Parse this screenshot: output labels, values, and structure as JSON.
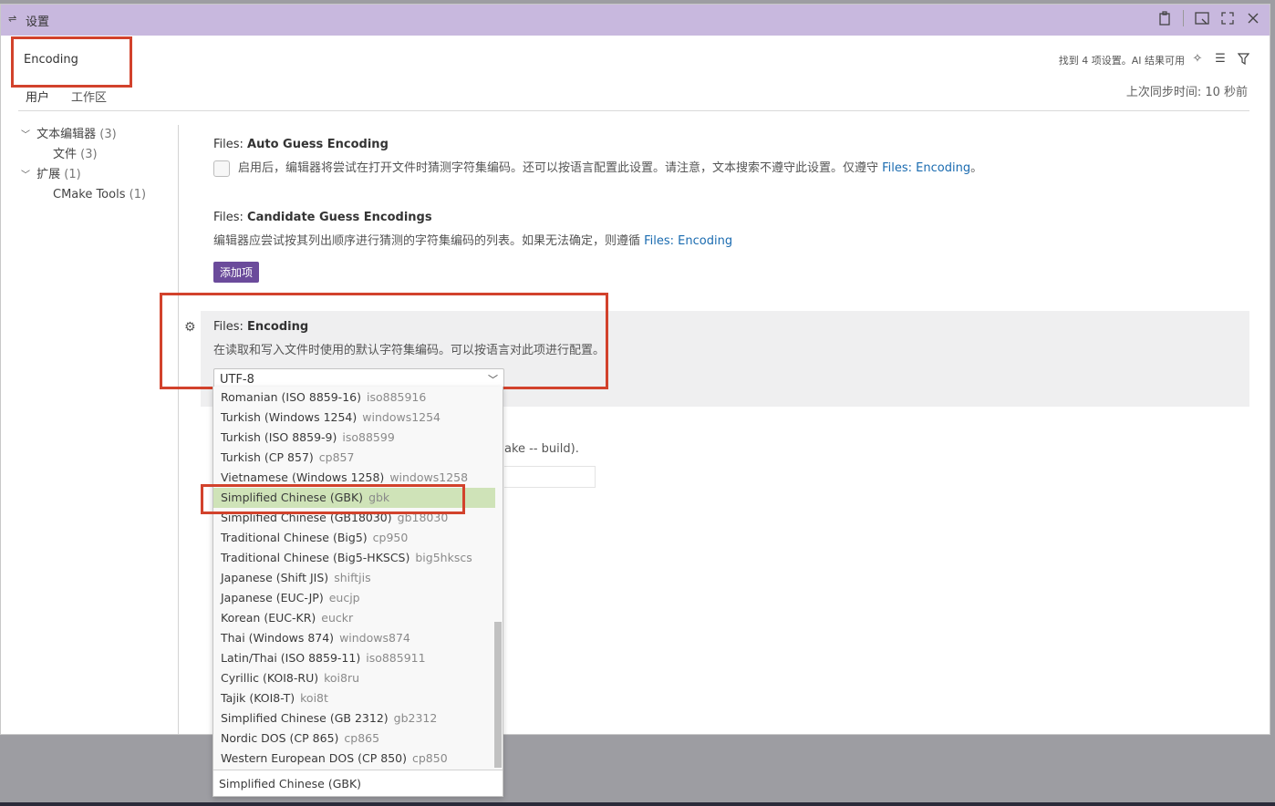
{
  "window": {
    "title": "设置"
  },
  "search": {
    "value": "Encoding",
    "status": "找到 4 项设置。AI 结果可用"
  },
  "tabs": [
    {
      "label": "用户"
    },
    {
      "label": "工作区"
    }
  ],
  "sync_status": "上次同步时间: 10 秒前",
  "toc": [
    {
      "label": "文本编辑器",
      "count": "(3)"
    },
    {
      "label": "文件",
      "count": "(3)"
    },
    {
      "label": "扩展",
      "count": "(1)"
    },
    {
      "label": "CMake Tools",
      "count": "(1)"
    }
  ],
  "settings": {
    "auto_guess": {
      "category": "Files: ",
      "name": "Auto Guess Encoding",
      "desc": "启用后，编辑器将尝试在打开文件时猜测字符集编码。还可以按语言配置此设置。请注意，文本搜索不遵守此设置。仅遵守 ",
      "link": "Files: Encoding",
      "desc_end": "。"
    },
    "candidate": {
      "category": "Files: ",
      "name": "Candidate Guess Encodings",
      "desc": "编辑器应尝试按其列出顺序进行猜测的字符集编码的列表。如果无法确定，则遵循 ",
      "link": "Files: Encoding",
      "button": "添加项"
    },
    "encoding": {
      "category": "Files: ",
      "name": "Encoding",
      "desc": "在读取和写入文件时使用的默认字符集编码。可以按语言对此项进行配置。",
      "value": "UTF-8"
    },
    "cmake_partial": "ake -- build)."
  },
  "dropdown": {
    "items": [
      {
        "label": "Romanian (ISO 8859-16)",
        "alias": "iso885916"
      },
      {
        "label": "Turkish (Windows 1254)",
        "alias": "windows1254"
      },
      {
        "label": "Turkish (ISO 8859-9)",
        "alias": "iso88599"
      },
      {
        "label": "Turkish (CP 857)",
        "alias": "cp857"
      },
      {
        "label": "Vietnamese (Windows 1258)",
        "alias": "windows1258"
      },
      {
        "label": "Simplified Chinese (GBK)",
        "alias": "gbk"
      },
      {
        "label": "Simplified Chinese (GB18030)",
        "alias": "gb18030"
      },
      {
        "label": "Traditional Chinese (Big5)",
        "alias": "cp950"
      },
      {
        "label": "Traditional Chinese (Big5-HKSCS)",
        "alias": "big5hkscs"
      },
      {
        "label": "Japanese (Shift JIS)",
        "alias": "shiftjis"
      },
      {
        "label": "Japanese (EUC-JP)",
        "alias": "eucjp"
      },
      {
        "label": "Korean (EUC-KR)",
        "alias": "euckr"
      },
      {
        "label": "Thai (Windows 874)",
        "alias": "windows874"
      },
      {
        "label": "Latin/Thai (ISO 8859-11)",
        "alias": "iso885911"
      },
      {
        "label": "Cyrillic (KOI8-RU)",
        "alias": "koi8ru"
      },
      {
        "label": "Tajik (KOI8-T)",
        "alias": "koi8t"
      },
      {
        "label": "Simplified Chinese (GB 2312)",
        "alias": "gb2312"
      },
      {
        "label": "Nordic DOS (CP 865)",
        "alias": "cp865"
      },
      {
        "label": "Western European DOS (CP 850)",
        "alias": "cp850"
      }
    ],
    "selected_index": 5,
    "footer": "Simplified Chinese (GBK)"
  },
  "colors": {
    "titlebar": "#c8b8de",
    "accent_button": "#6b4b9b",
    "link": "#1a6bb0",
    "highlight_box": "#d2422c",
    "selected_item": "#cfe3b8"
  }
}
